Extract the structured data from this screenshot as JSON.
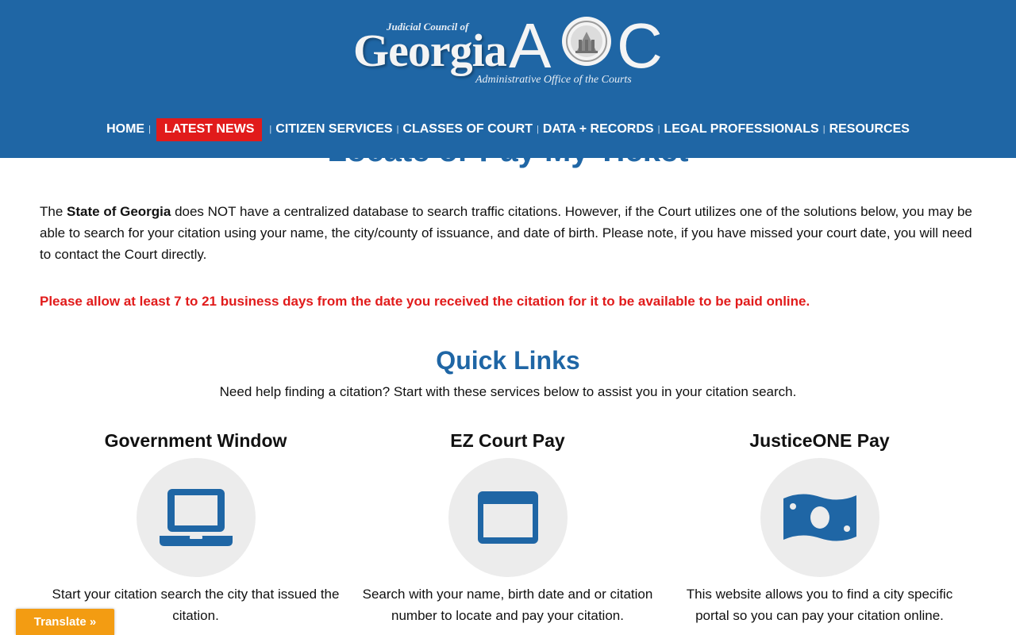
{
  "header": {
    "logo": {
      "line1": "Judicial Council of",
      "state": "Georgia",
      "letter_a": "A",
      "letter_c": "C",
      "subtitle": "Administrative Office of the Courts"
    },
    "nav": [
      {
        "label": "HOME",
        "active": false
      },
      {
        "label": "LATEST NEWS",
        "active": true
      },
      {
        "label": "CITIZEN SERVICES",
        "active": false
      },
      {
        "label": "CLASSES OF COURT",
        "active": false
      },
      {
        "label": "DATA + RECORDS",
        "active": false
      },
      {
        "label": "LEGAL PROFESSIONALS",
        "active": false
      },
      {
        "label": "RESOURCES",
        "active": false
      }
    ],
    "colors": {
      "bar": "#1f66a5",
      "active": "#e11b1b"
    }
  },
  "main": {
    "page_title": "Locate or Pay My Ticket",
    "intro": {
      "before": "The ",
      "bold": "State of Georgia",
      "after": " does NOT have a centralized database to search traffic citations. However, if the Court utilizes one of the solutions below, you may be able to search for your citation using your name, the city/county of issuance, and date of birth. Please note, if you have missed your court date, you will need to contact the Court directly."
    },
    "warning": "Please allow at least 7 to 21 business days from the date you received the citation for it to be available to be paid online.",
    "quick_links": {
      "title": "Quick Links",
      "subtitle": "Need help finding a citation? Start with these services below to assist you in your citation search.",
      "cards": [
        {
          "title": "Government Window",
          "icon": "laptop-icon",
          "description": "Start your citation search the city that issued the citation."
        },
        {
          "title": "EZ Court Pay",
          "icon": "browser-window-icon",
          "description": "Search with your name, birth date and or citation number to locate and pay your citation."
        },
        {
          "title": "JusticeONE Pay",
          "icon": "money-bill-icon",
          "description": "This website allows you to find a city specific portal so you can pay your citation online."
        }
      ]
    }
  },
  "translate": {
    "label": "Translate »",
    "color": "#f39c12"
  }
}
